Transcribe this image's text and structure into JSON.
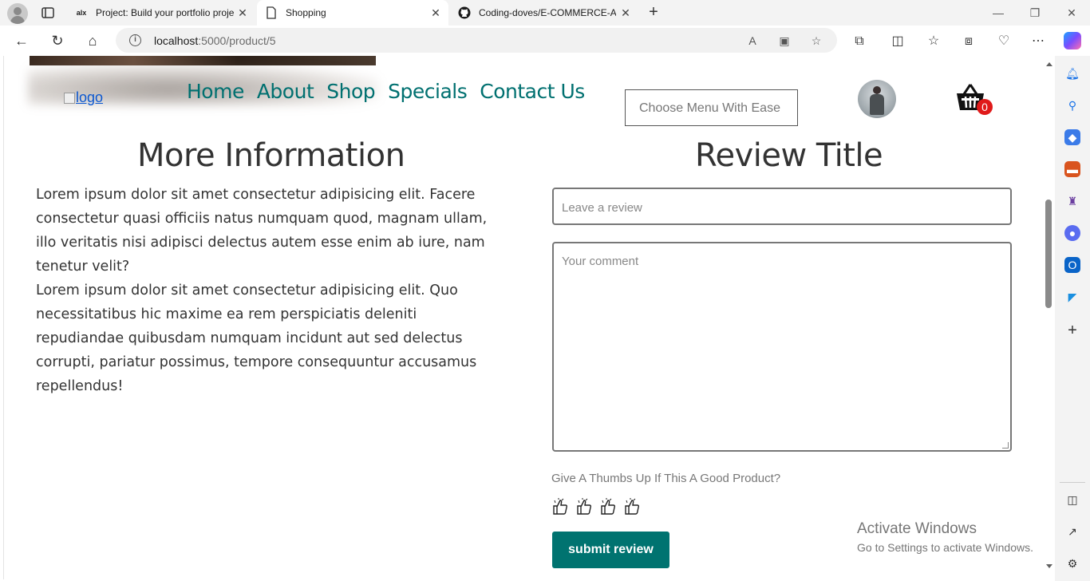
{
  "browser": {
    "tabs": [
      {
        "favicon": "alx",
        "title": "Project: Build your portfolio proje",
        "active": false
      },
      {
        "favicon": "page-icon",
        "title": "Shopping",
        "active": true
      },
      {
        "favicon": "github-icon",
        "title": "Coding-doves/E-COMMERCE-AL",
        "active": false
      }
    ],
    "url_host": "localhost",
    "url_path": ":5000/product/5"
  },
  "site": {
    "logo_alt": "logo",
    "nav": [
      "Home",
      "About",
      "Shop",
      "Specials",
      "Contact Us"
    ],
    "menu_select_placeholder": "Choose Menu With Ease",
    "cart_count": "0"
  },
  "more_info": {
    "title": "More Information",
    "paragraphs": [
      "Lorem ipsum dolor sit amet consectetur adipisicing elit. Facere consectetur quasi officiis natus numquam quod, magnam ullam, illo veritatis nisi adipisci delectus autem esse enim ab iure, nam tenetur velit?",
      "Lorem ipsum dolor sit amet consectetur adipisicing elit. Quo necessitatibus hic maxime ea rem perspiciatis deleniti repudiandae quibusdam numquam incidunt aut sed delectus corrupti, pariatur possimus, tempore consequuntur accusamus repellendus!"
    ]
  },
  "review": {
    "title": "Review Title",
    "review_placeholder": "Leave a review",
    "comment_placeholder": "Your comment",
    "thumbs_question": "Give A Thumbs Up If This A Good Product?",
    "submit_label": "submit review"
  },
  "watermark": {
    "line1": "Activate Windows",
    "line2": "Go to Settings to activate Windows."
  }
}
